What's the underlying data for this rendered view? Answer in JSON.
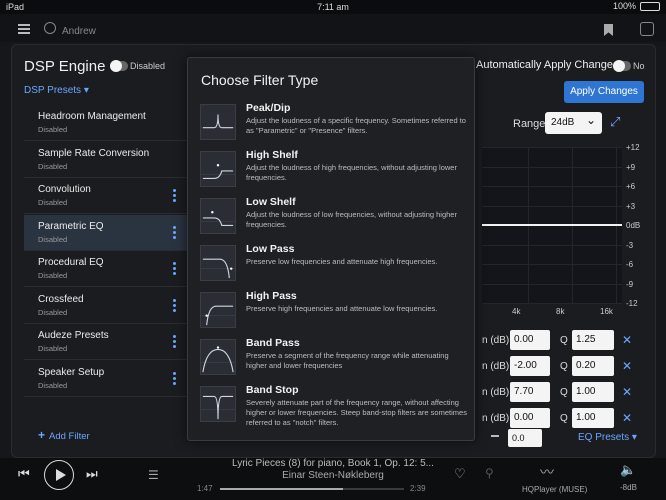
{
  "status_bar": {
    "device": "iPad",
    "time": "7:11 am",
    "battery": "100%"
  },
  "top_bar": {
    "user": "Andrew"
  },
  "dsp": {
    "title": "DSP Engine",
    "enabled_label": "Disabled",
    "presets_label": "DSP Presets",
    "auto_apply_label": "Automatically Apply Changes",
    "auto_apply_value": "No",
    "apply_button": "Apply Changes",
    "range_label": "Range:",
    "range_value": "24dB",
    "db_ticks": [
      "+12",
      "+9",
      "+6",
      "+3",
      "0dB",
      "-3",
      "-6",
      "-9",
      "-12"
    ],
    "freq_ticks": [
      "4k",
      "8k",
      "16k"
    ],
    "gain_label": "n (dB)",
    "q_label": "Q",
    "bands": [
      {
        "gain": "0.00",
        "q": "1.25"
      },
      {
        "gain": "-2.00",
        "q": "0.20"
      },
      {
        "gain": "7.70",
        "q": "1.00"
      },
      {
        "gain": "0.00",
        "q": "1.00"
      }
    ],
    "preamp_value": "0.0",
    "eq_presets_label": "EQ Presets"
  },
  "sidebar": {
    "items": [
      {
        "title": "Headroom Management",
        "status": "Disabled"
      },
      {
        "title": "Sample Rate Conversion",
        "status": "Disabled"
      },
      {
        "title": "Convolution",
        "status": "Disabled"
      },
      {
        "title": "Parametric EQ",
        "status": "Disabled"
      },
      {
        "title": "Procedural EQ",
        "status": "Disabled"
      },
      {
        "title": "Crossfeed",
        "status": "Disabled"
      },
      {
        "title": "Audeze Presets",
        "status": "Disabled"
      },
      {
        "title": "Speaker Setup",
        "status": "Disabled"
      }
    ],
    "add_filter": "Add Filter"
  },
  "modal": {
    "title": "Choose Filter Type",
    "options": [
      {
        "name": "Peak/Dip",
        "desc": "Adjust the loudness of a specific frequency. Sometimes referred to as \"Parametric\" or \"Presence\" filters."
      },
      {
        "name": "High Shelf",
        "desc": "Adjust the loudness of high frequencies, without adjusting lower frequencies."
      },
      {
        "name": "Low Shelf",
        "desc": "Adjust the loudness of low frequencies, without adjusting higher frequencies."
      },
      {
        "name": "Low Pass",
        "desc": "Preserve low frequencies and attenuate high frequencies."
      },
      {
        "name": "High Pass",
        "desc": "Preserve high frequencies and attenuate low frequencies."
      },
      {
        "name": "Band Pass",
        "desc": "Preserve a segment of the frequency range while attenuating higher and lower frequencies"
      },
      {
        "name": "Band Stop",
        "desc": "Severely attenuate part of the frequency range, without affecting higher or lower frequencies. Steep band-stop filters are sometimes referred to as \"notch\" filters."
      }
    ]
  },
  "player": {
    "track_title": "Lyric Pieces (8) for piano, Book 1, Op. 12: 5...",
    "artist": "Einar Steen-Nøkleberg",
    "elapsed": "1:47",
    "total": "2:39",
    "progress": 0.67,
    "output_label": "HQPlayer (MUSE)",
    "volume": "-8dB"
  },
  "colors": {
    "accent": "#6aa7ff",
    "apply_button": "#2f76d2",
    "active_row": "#2a3340"
  }
}
